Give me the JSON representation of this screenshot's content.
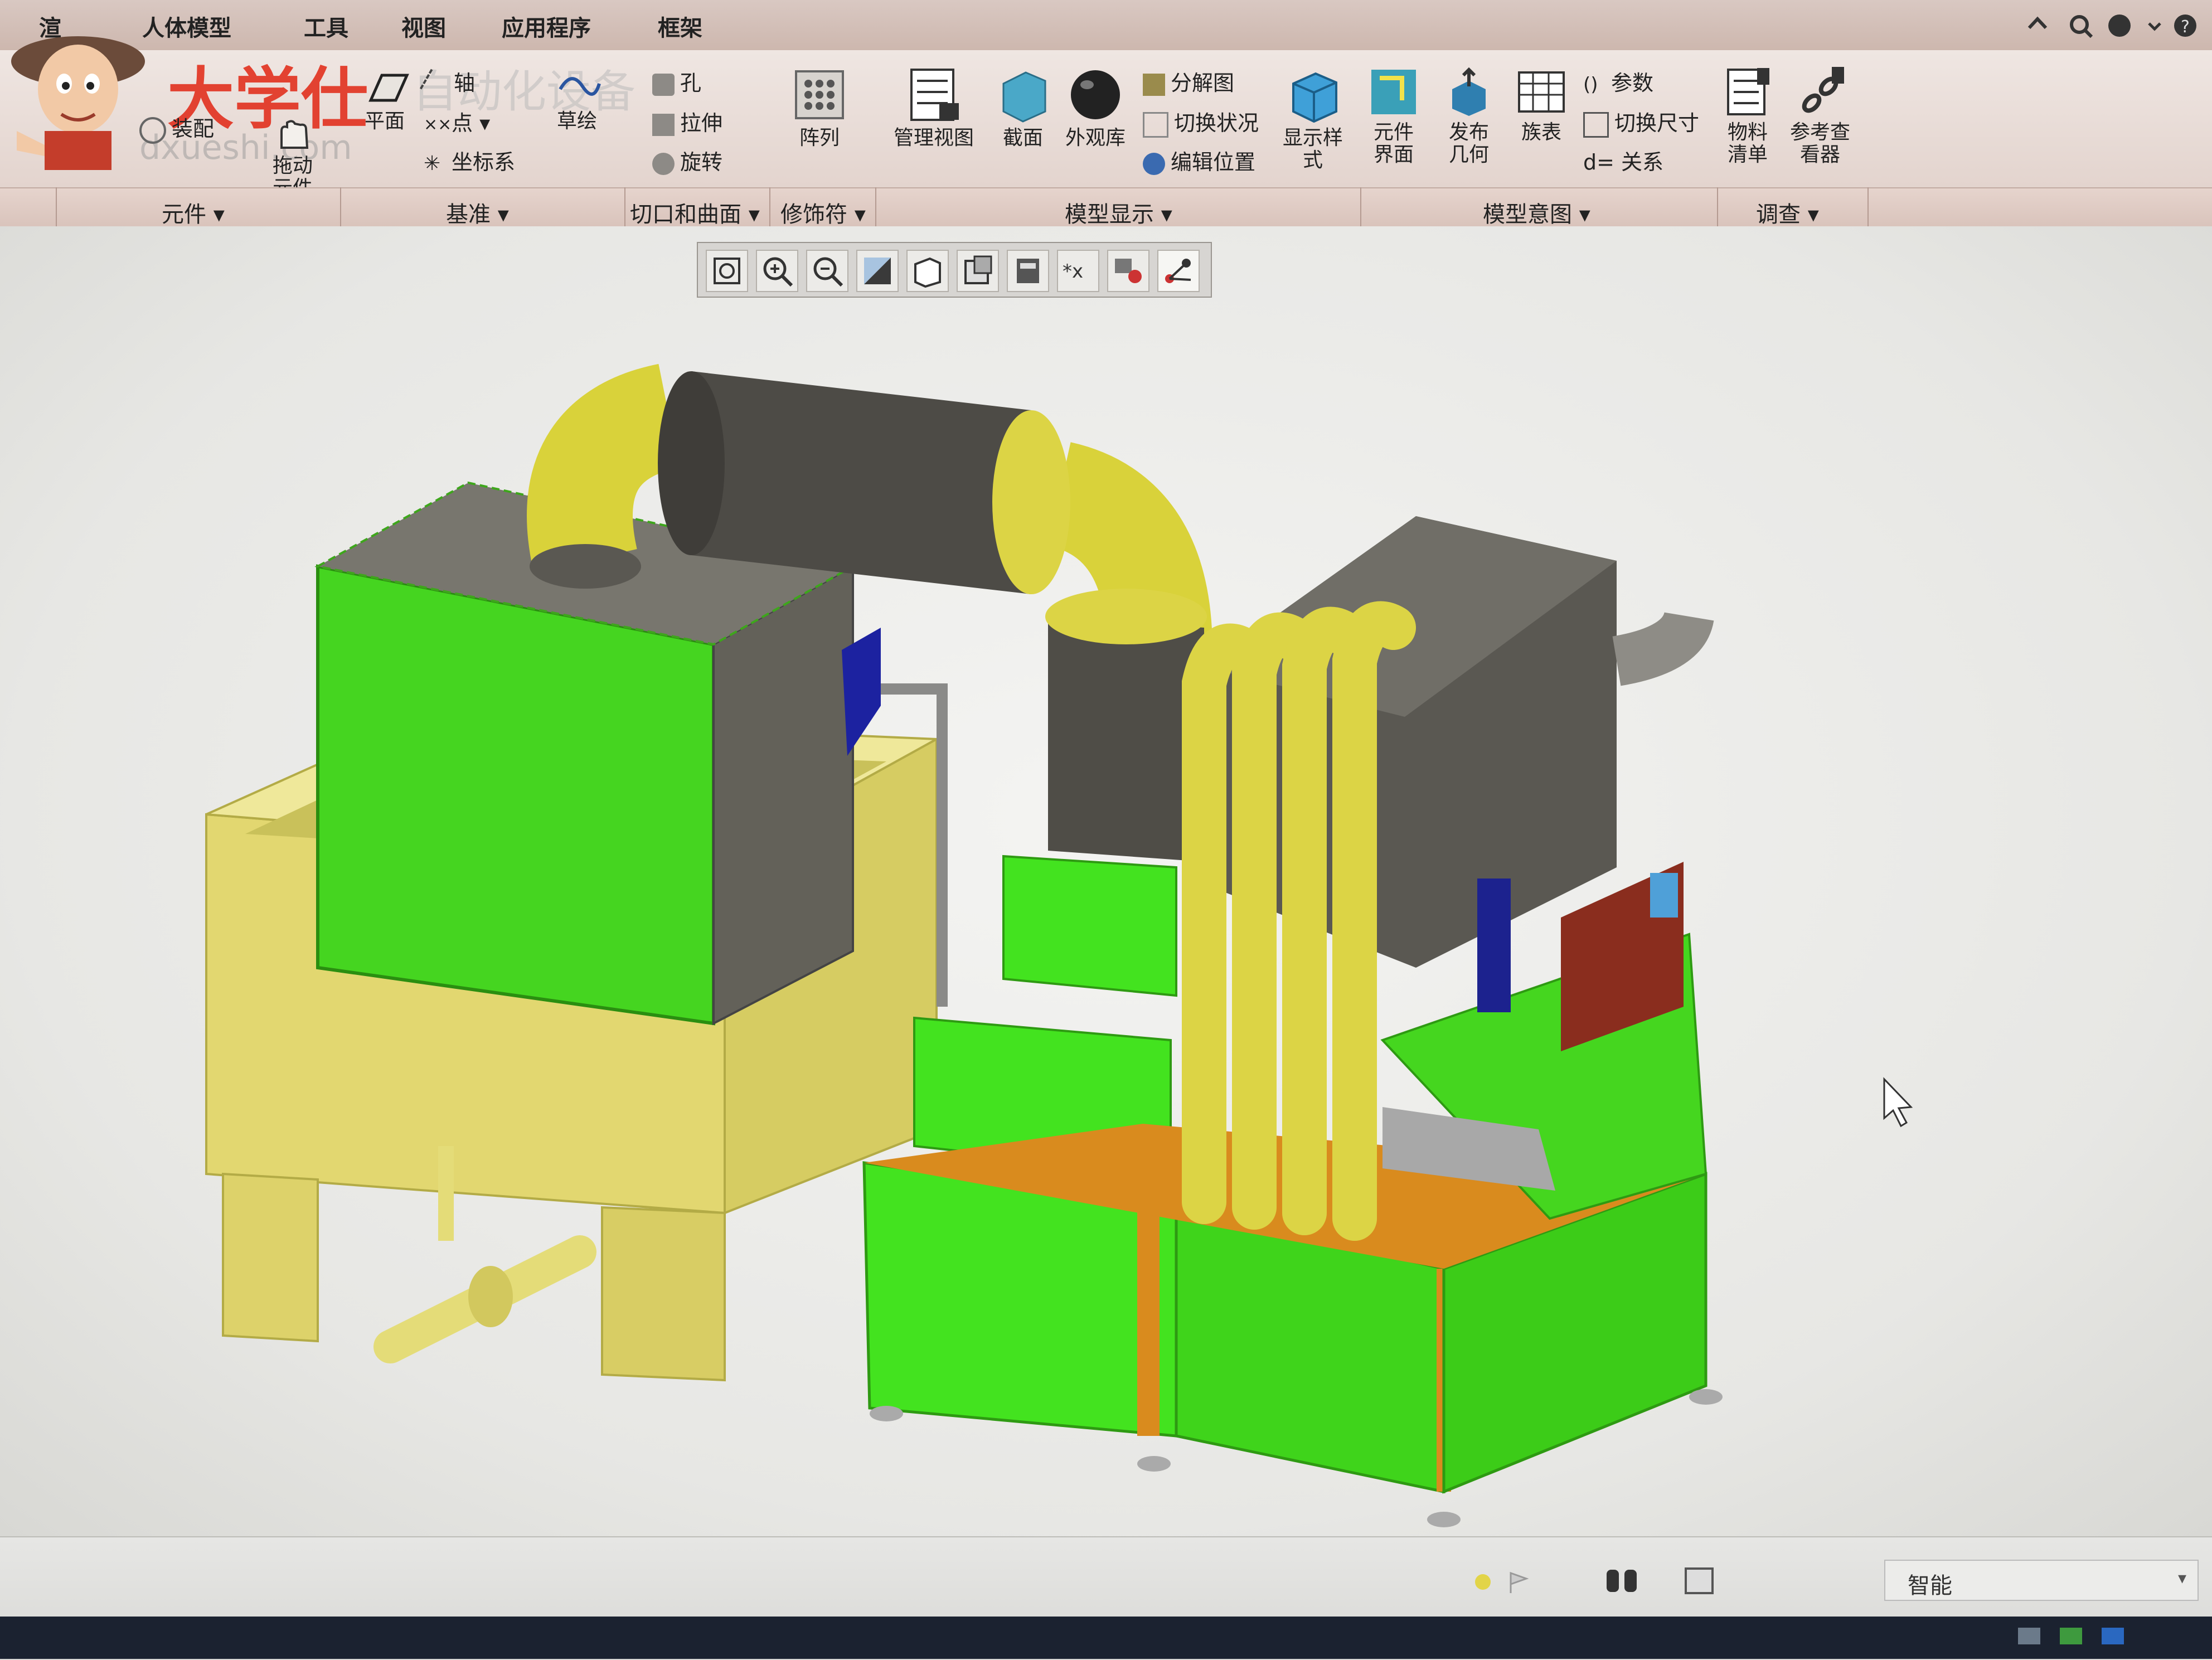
{
  "window": {
    "title_ring": ""
  },
  "menubar": {
    "items": [
      "渲",
      "人体模型",
      "工具",
      "视图",
      "应用程序",
      "框架"
    ]
  },
  "watermark": {
    "text": "大学仕",
    "subtext": "自动化设备",
    "url_text": "dxueshi.com"
  },
  "ribbon": {
    "component": {
      "drag_label": "拖动\n元件",
      "assemble_label": "装配"
    },
    "datum": {
      "plane": "平面",
      "axis": "轴",
      "point": "点",
      "csys": "坐标系"
    },
    "sketch": {
      "label": "草绘"
    },
    "cut_surface": {
      "hole": "孔",
      "extrude": "拉伸",
      "revolve": "旋转"
    },
    "modifiers": {
      "pattern": "阵列"
    },
    "model_display": {
      "manage_views": "管理视图",
      "section": "截面",
      "appearance": "外观库",
      "exploded": "分解图",
      "toggle_status": "切换状况",
      "edit_position": "编辑位置",
      "display_style": "显示样\n式"
    },
    "model_intent": {
      "component_interface": "元件\n界面",
      "publish_geometry": "发布\n几何",
      "family_table": "族表",
      "parameters": "参数",
      "switch_dims": "切换尺寸",
      "relations": "d= 关系"
    },
    "investigate": {
      "bom": "物料\n清单",
      "reference_viewer": "参考查\n看器"
    },
    "groups": [
      "元件 ▾",
      "基准 ▾",
      "切口和曲面 ▾",
      "修饰符 ▾",
      "模型显示 ▾",
      "模型意图 ▾",
      "调查 ▾"
    ]
  },
  "status": {
    "filter": "智能"
  },
  "colors": {
    "machine_green": "#43e31f",
    "machine_yellow": "#e3dc6a",
    "tank_yellow": "#e6dc73",
    "housing_dark": "#4f4d47",
    "orange_frame": "#d98b1e"
  }
}
